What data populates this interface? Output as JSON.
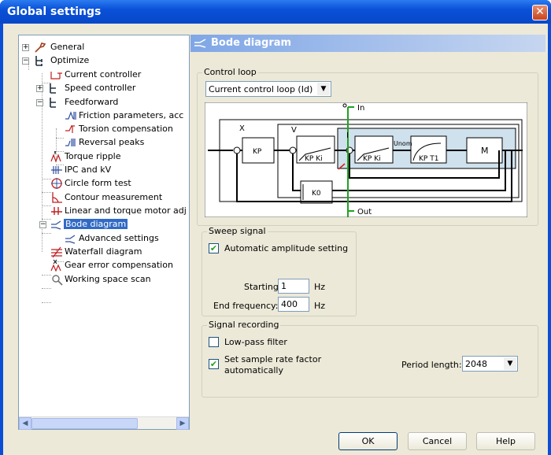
{
  "window": {
    "title": "Global settings",
    "close_glyph": "✕"
  },
  "tree": {
    "items": [
      {
        "label": "General",
        "icon": "general-icon"
      },
      {
        "label": "Optimize",
        "icon": "optimize-icon"
      },
      {
        "label": "Current controller",
        "icon": "current-controller-icon"
      },
      {
        "label": "Speed controller",
        "icon": "speed-controller-icon"
      },
      {
        "label": "Feedforward",
        "icon": "feedforward-icon"
      },
      {
        "label": "Friction parameters, acc",
        "icon": "friction-icon"
      },
      {
        "label": "Torsion compensation",
        "icon": "torsion-icon"
      },
      {
        "label": "Reversal peaks",
        "icon": "reversal-icon"
      },
      {
        "label": "Torque ripple",
        "icon": "torque-ripple-icon"
      },
      {
        "label": "IPC and kV",
        "icon": "ipc-icon"
      },
      {
        "label": "Circle form test",
        "icon": "circle-form-icon"
      },
      {
        "label": "Contour measurement",
        "icon": "contour-icon"
      },
      {
        "label": "Linear and torque motor adj",
        "icon": "linear-motor-icon"
      },
      {
        "label": "Bode diagram",
        "icon": "bode-icon"
      },
      {
        "label": "Advanced settings",
        "icon": "advanced-icon"
      },
      {
        "label": "Waterfall diagram",
        "icon": "waterfall-icon"
      },
      {
        "label": "Gear error compensation",
        "icon": "gear-error-icon"
      },
      {
        "label": "Working space scan",
        "icon": "scan-icon"
      }
    ]
  },
  "panel": {
    "title": "Bode diagram"
  },
  "control_loop": {
    "group_label": "Control loop",
    "selected": "Current control loop (Id)"
  },
  "diagram": {
    "in_label": "In",
    "out_label": "Out",
    "x_label": "X",
    "v_label": "V",
    "i_label": "I",
    "kp": "KP",
    "kp_ki": "KP Ki",
    "unom": "Unom",
    "kp_t1": "KP T1",
    "k0": "K0",
    "m": "M"
  },
  "sweep": {
    "group_label": "Sweep signal",
    "auto_amp_label": "Automatic amplitude setting",
    "auto_amp_checked": true,
    "starting_label": "Starting",
    "starting_value": "1",
    "starting_unit": "Hz",
    "end_label": "End frequency:",
    "end_value": "400",
    "end_unit": "Hz"
  },
  "recording": {
    "group_label": "Signal recording",
    "lowpass_label": "Low-pass filter",
    "lowpass_checked": false,
    "sample_rate_label_1": "Set sample rate factor",
    "sample_rate_label_2": "automatically",
    "sample_rate_checked": true,
    "period_label": "Period length:",
    "period_value": "2048"
  },
  "buttons": {
    "ok": "OK",
    "cancel": "Cancel",
    "help": "Help"
  }
}
